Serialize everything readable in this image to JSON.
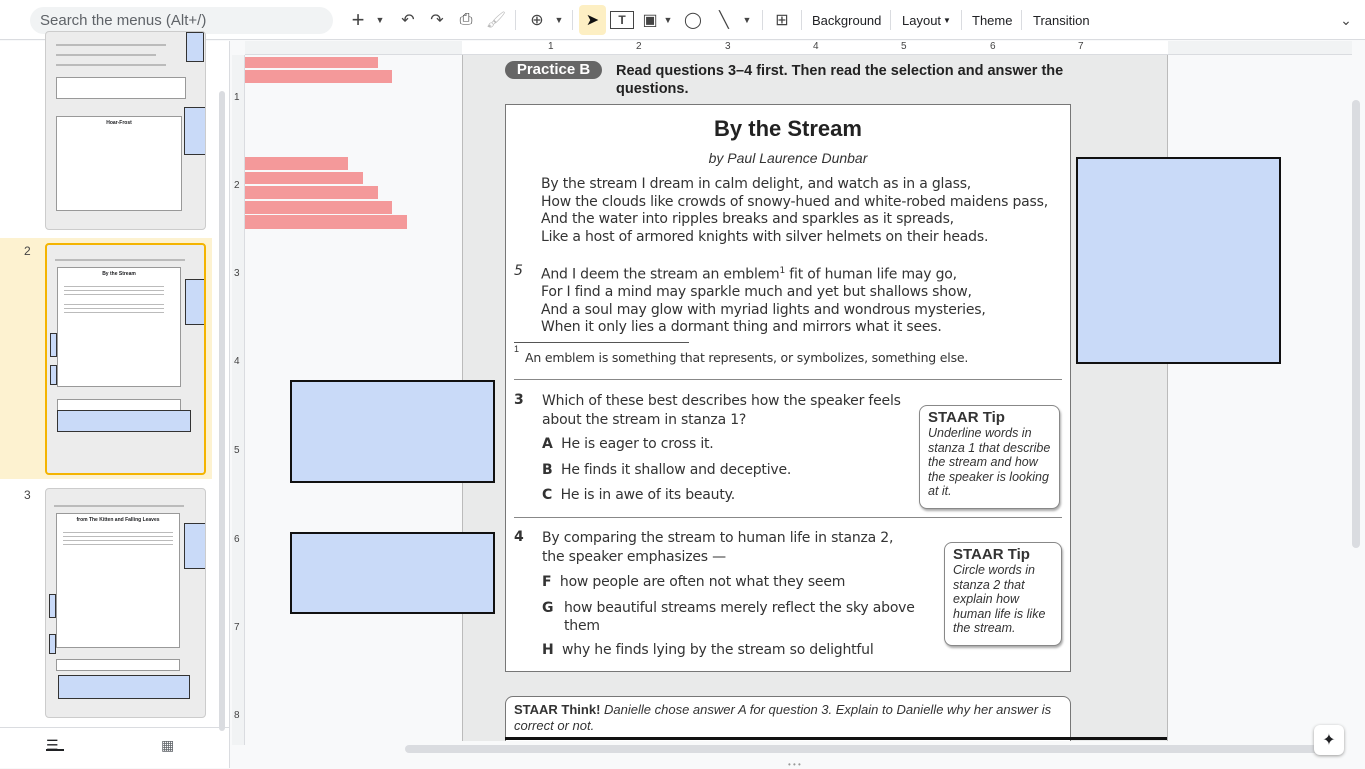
{
  "toolbar": {
    "search_placeholder": "Search the menus (Alt+/)",
    "background": "Background",
    "layout": "Layout",
    "theme": "Theme",
    "transition": "Transition"
  },
  "filmstrip": {
    "slides": [
      {
        "number": "1",
        "title": "Hoar-Frost"
      },
      {
        "number": "2",
        "title": "By the Stream"
      },
      {
        "number": "3",
        "title": "from The Kitten and Falling Leaves"
      }
    ],
    "selected": 2
  },
  "rulers": {
    "horizontal": [
      "1",
      "2",
      "3",
      "4",
      "5",
      "6",
      "7"
    ],
    "vertical": [
      "1",
      "2",
      "3",
      "4",
      "5",
      "6",
      "7",
      "8"
    ]
  },
  "slide": {
    "badge": "Practice B",
    "instruction": "Read questions 3–4 first. Then read the selection and answer the questions.",
    "title": "By the Stream",
    "byline": "by Paul Laurence Dunbar",
    "stanza1": [
      "By the stream I dream in calm delight, and watch as in a glass,",
      "How the clouds like crowds of snowy-hued and white-robed maidens pass,",
      "And the water into ripples breaks and sparkles as it spreads,",
      "Like a host of armored knights with silver helmets on their heads."
    ],
    "line_number": "5",
    "stanza2_first": "And I deem the stream an emblem",
    "footnote_mark": "1",
    "stanza2_first_end": " fit of human life may go,",
    "stanza2": [
      "For I find a mind may sparkle much and yet but shallows show,",
      "And a soul may glow with myriad lights and wondrous mysteries,",
      "When it only lies a dormant thing and mirrors what it sees."
    ],
    "footnote": "An emblem is something that represents, or symbolizes, something else.",
    "q3": {
      "number": "3",
      "text": "Which of these best describes how the speaker feels about the stream in stanza 1?",
      "options": [
        {
          "letter": "A",
          "text": "He is eager to cross it."
        },
        {
          "letter": "B",
          "text": "He finds it shallow and deceptive."
        },
        {
          "letter": "C",
          "text": "He is in awe of its beauty."
        }
      ],
      "tip_title": "STAAR Tip",
      "tip_text": "Underline words in stanza 1 that describe the stream and how the speaker is looking at it."
    },
    "q4": {
      "number": "4",
      "text": "By comparing the stream to human life in stanza 2, the speaker emphasizes —",
      "options": [
        {
          "letter": "F",
          "text": "how people are often not what they seem"
        },
        {
          "letter": "G",
          "text": "how beautiful streams merely reflect the sky above them"
        },
        {
          "letter": "H",
          "text": "why he finds lying by the stream so delightful"
        }
      ],
      "tip_title": "STAAR Tip",
      "tip_text": "Circle words in stanza 2 that explain how human life is like the stream."
    },
    "think_label": "STAAR Think!",
    "think_text": " Danielle chose answer A for question 3. Explain to Danielle why her answer is correct or not."
  }
}
